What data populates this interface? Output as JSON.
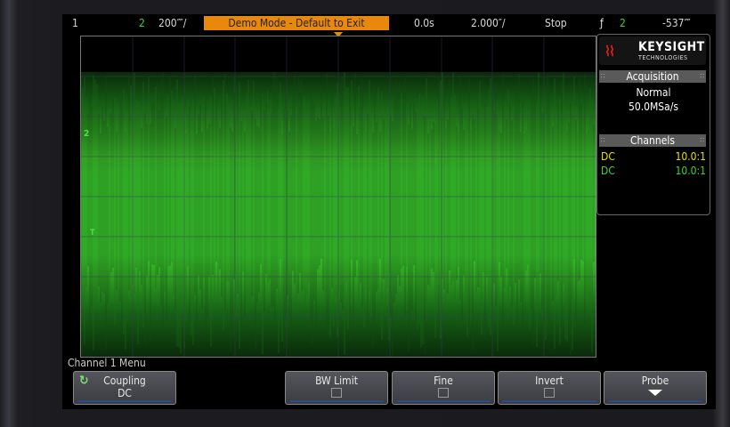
{
  "status_bar": {
    "ch1_number": "1",
    "ch2_number": "2",
    "ch2_scale": "200⁗/",
    "demo_banner": "Demo Mode - Default to Exit",
    "time_delay": "0.0s",
    "time_scale": "2.000″/",
    "run_state": "Stop",
    "trigger_icon": "ƒ",
    "trigger_source": "2",
    "trigger_level": "-537⁗"
  },
  "markers": {
    "channel_marker": "2",
    "trigger_marker": "T"
  },
  "panel": {
    "logo_name": "KEYSIGHT",
    "logo_sub": "TECHNOLOGIES",
    "acquisition_title": "Acquisition",
    "acquisition_mode": "Normal",
    "sample_rate": "50.0MSa/s",
    "channels_title": "Channels",
    "channels": [
      {
        "coupling": "DC",
        "probe": "10.0:1",
        "color": "#e8e000"
      },
      {
        "coupling": "DC",
        "probe": "10.0:1",
        "color": "#38d838"
      }
    ]
  },
  "softkeys": {
    "menu_title": "Channel 1 Menu",
    "coupling_label": "Coupling",
    "coupling_value": "DC",
    "bw_limit_label": "BW Limit",
    "fine_label": "Fine",
    "invert_label": "Invert",
    "probe_label": "Probe"
  },
  "colors": {
    "banner": "#e8890c",
    "channel2": "#38d838",
    "channel1": "#e8e000"
  },
  "icons": {
    "coupling": "rotate-arrows-icon",
    "probe": "down-arrow-icon",
    "logo": "keysight-wave-logo-icon"
  }
}
